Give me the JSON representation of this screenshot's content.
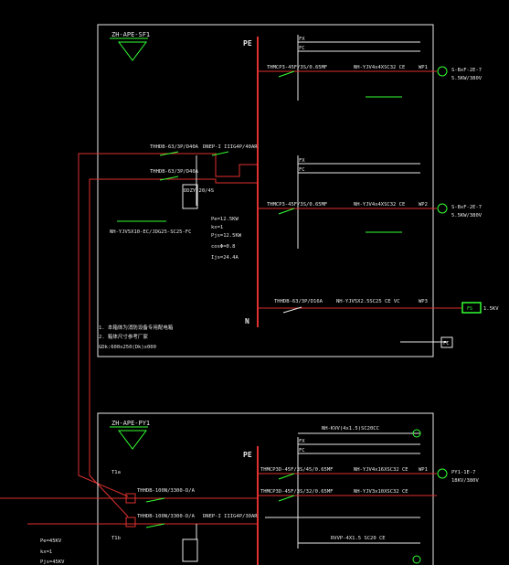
{
  "panel1": {
    "id": "ZH-APE-SF1",
    "ground_label": "PE",
    "neutral_label": "N",
    "main_breaker": "THHDB-63/3P/D40A",
    "spd": "DNEP-I IIIG4P/40AR",
    "isolator": "THHDB-63/3P/D40A",
    "meter": "DDZY-20/4S",
    "input_cable": "NH-YJV5X10-EC/JDG25-SC25-FC",
    "load_calc": [
      "Pe=12.5KW",
      "kx=1",
      "Pjs=12.5KW",
      "cosΦ=0.8",
      "Ijs=24.4A"
    ],
    "feeders": [
      {
        "breaker": "THMCP3-45F/3S/0.65MF",
        "fx": "FX",
        "fc": "FC",
        "cable": "NH-YJV4x4XSC32 CE",
        "circuit": "WP1",
        "load": "S-BxF-2E-7",
        "rating": "5.5KW/380V"
      },
      {
        "breaker": "THMCP3-45F/3S/0.65MF",
        "fx": "FX",
        "fc": "FC",
        "cable": "NH-YJV4x4XSC32 CE",
        "circuit": "WP2",
        "load": "S-BxF-2E-7",
        "rating": "5.5KW/380V"
      },
      {
        "breaker": "THHDB-63/3P/D16A",
        "cable": "NH-YJV5X2.5SC25 CE VC",
        "circuit": "WP3",
        "load_box": "FS",
        "rating": "1.5KV"
      }
    ],
    "note": "FC",
    "notes_block": [
      "1. 本箱体为消防设备专用配电箱",
      "2. 箱体尺寸参考厂家",
      "GDk:600x250(Dk)x000"
    ]
  },
  "panel2": {
    "id": "ZH-APE-PY1",
    "ground_label": "PE",
    "breaker_a": "THHDB-100N/3300-D/A",
    "breaker_b": "THHDB-100N/3300-D/A",
    "spd": "DNEP-I IIIG4P/30AR",
    "tag1": "T1a",
    "tag2": "T1b",
    "signal_cable": "NH-KVV(4x1.5)SC20CC",
    "load_calc": [
      "Pe=45KV",
      "kx=1",
      "Pjs=45KV"
    ],
    "feeders": [
      {
        "breaker": "THMCP3D-45F/3S/45/0.65MF",
        "fx": "FX",
        "fc": "FC",
        "cable": "NH-YJV4x16XSC32 CE",
        "circuit": "WP1",
        "load": "PY1-1E-7",
        "rating": "18KV/380V"
      },
      {
        "breaker": "THMCP3D-45F/3S/32/0.65MF",
        "cable": "NH-YJV3x10XSC32 CE"
      },
      {
        "cable": "RVVP-4X1.5 SC20 CE"
      }
    ]
  }
}
